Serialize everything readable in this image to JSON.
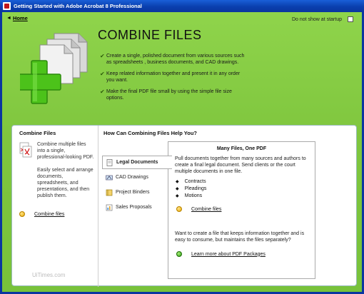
{
  "window": {
    "title": "Getting Started with Adobe Acrobat 8 Professional"
  },
  "nav": {
    "home_label": "Home",
    "home_arrow": "◄"
  },
  "startup": {
    "label": "Do not show at startup",
    "checked": false
  },
  "hero": {
    "title": "COMBINE FILES",
    "bullets": [
      "Create a single, polished document from various sources such as spreadsheets , business documents, and CAD drawings.",
      "Keep related information together and present it in any order you want.",
      "Make the final PDF file small by using the simple file size options."
    ]
  },
  "left_panel": {
    "heading": "Combine Files",
    "text1": "Combine multiple files into a single, professional-looking PDF.",
    "text2": "Easily select and arrange documents, spreadsheets, and presentations, and then publish them.",
    "link": "Combine files",
    "watermark": "UiTimes.com"
  },
  "right_panel": {
    "heading": "How Can Combining Files Help You?",
    "tabs": [
      {
        "label": "Legal Documents",
        "icon": "legal-document-icon",
        "active": true
      },
      {
        "label": "CAD Drawings",
        "icon": "cad-drawing-icon",
        "active": false
      },
      {
        "label": "Project Binders",
        "icon": "binder-icon",
        "active": false
      },
      {
        "label": "Sales Proposals",
        "icon": "sales-proposal-icon",
        "active": false
      }
    ],
    "content": {
      "heading": "Many Files, One PDF",
      "paragraph1": "Pull documents together from many sources and authors to create a final legal document. Send clients or the court multiple documents in one file.",
      "list": [
        "Contracts",
        "Pleadings",
        "Motions"
      ],
      "link1": "Combine files",
      "paragraph2": "Want to create a file that keeps information together and is easy to consume, but maintains the files separately?",
      "link2": "Learn more about PDF Packages"
    }
  },
  "colors": {
    "background_green": "#7fc63e",
    "titlebar_blue": "#0a36a0",
    "plus_green": "#4cc21a"
  }
}
